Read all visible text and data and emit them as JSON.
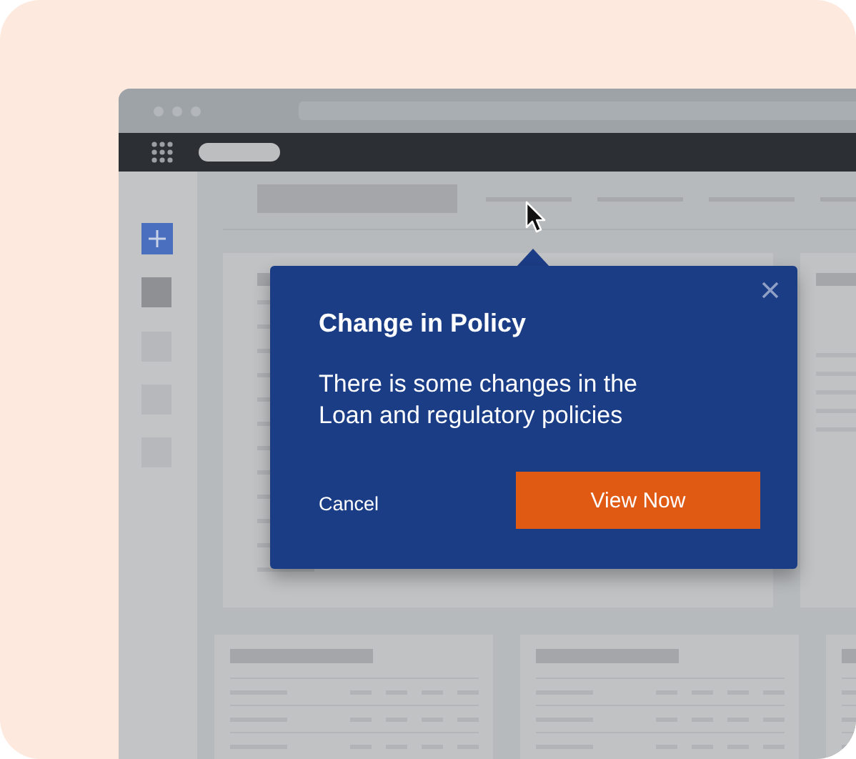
{
  "sidebar": {
    "items": [
      {
        "selected": true
      },
      {
        "selected": false
      },
      {
        "selected": false
      },
      {
        "selected": false
      }
    ]
  },
  "popover": {
    "title": "Change in Policy",
    "message": "There is some changes in the\nLoan and regulatory policies",
    "buttons": [
      {
        "label": "Cancel",
        "kind": "text"
      },
      {
        "label": "View Now",
        "kind": "primary"
      }
    ]
  }
}
